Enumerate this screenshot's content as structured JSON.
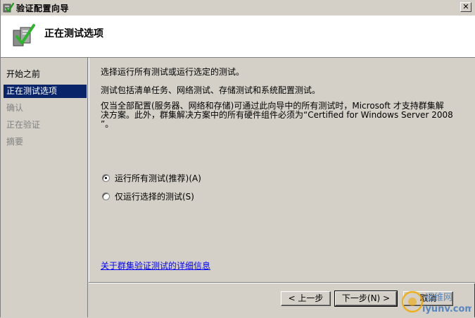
{
  "window": {
    "title": "验证配置向导",
    "close_glyph": "✕"
  },
  "header": {
    "title": "正在测试选项"
  },
  "nav": {
    "items": [
      {
        "label": "开始之前",
        "state": "normal"
      },
      {
        "label": "正在测试选项",
        "state": "active"
      },
      {
        "label": "确认",
        "state": "disabled"
      },
      {
        "label": "正在验证",
        "state": "disabled"
      },
      {
        "label": "摘要",
        "state": "disabled"
      }
    ]
  },
  "content": {
    "intro": "选择运行所有测试或运行选定的测试。",
    "desc1": "测试包括清单任务、网络测试、存储测试和系统配置测试。",
    "desc2_line1": "仅当全部配置(服务器、网络和存储)可通过此向导中的所有测试时，Microsoft 才支持群集解",
    "desc2_line2": "决方案。此外，群集解决方案中的所有硬件组件必须为“Certified for Windows Server 2008",
    "desc2_line3": "”。",
    "options": [
      {
        "label": "运行所有测试(推荐)(A)",
        "checked": true
      },
      {
        "label": "仅运行选择的测试(S)",
        "checked": false
      }
    ],
    "link": "关于群集验证测试的详细信息"
  },
  "buttons": {
    "prev": "< 上一步",
    "next": "下一步(N) >",
    "cancel": "取消"
  },
  "watermark": {
    "cn": "运维网",
    "url": "iyunv.com"
  },
  "colors": {
    "highlight": "#0a246a",
    "link": "#0000ff",
    "face": "#d4d0c8"
  }
}
